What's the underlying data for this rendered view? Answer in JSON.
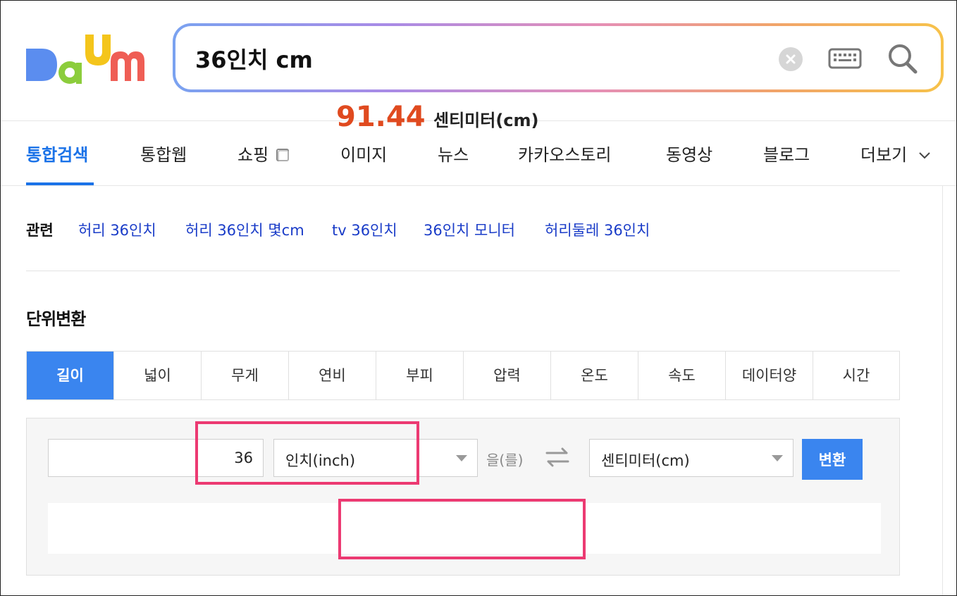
{
  "logo": {
    "text": "Daum",
    "colors": [
      "#5b8def",
      "#f4c51b",
      "#8ccd3c",
      "#ef5e55"
    ]
  },
  "search": {
    "query": "36인치 cm",
    "icons": [
      "clear-icon",
      "keyboard-icon",
      "search-icon"
    ]
  },
  "tabs": [
    {
      "label": "통합검색",
      "active": true
    },
    {
      "label": "통합웹"
    },
    {
      "label": "쇼핑"
    },
    {
      "label": "이미지"
    },
    {
      "label": "뉴스"
    },
    {
      "label": "카카오스토리"
    },
    {
      "label": "동영상"
    },
    {
      "label": "블로그"
    },
    {
      "label": "더보기"
    }
  ],
  "related": {
    "label": "관련",
    "links": [
      "허리 36인치",
      "허리 36인치 몇cm",
      "tv 36인치",
      "36인치 모니터",
      "허리둘레 36인치"
    ]
  },
  "converter": {
    "title": "단위변환",
    "unit_tabs": [
      "길이",
      "넓이",
      "무게",
      "연비",
      "부피",
      "압력",
      "온도",
      "속도",
      "데이터양",
      "시간"
    ],
    "active_unit_tab": "길이",
    "input_value": "36",
    "from_unit": "인치(inch)",
    "particle": "을(를)",
    "to_unit": "센티미터(cm)",
    "convert_label": "변환",
    "result_value": "91.44",
    "result_unit": "센티미터(cm)"
  },
  "colors": {
    "accent": "#1a72e8",
    "button": "#3a85ef",
    "result": "#e04a1f",
    "highlight": "#ec3a72",
    "link": "#1a3cc8"
  }
}
